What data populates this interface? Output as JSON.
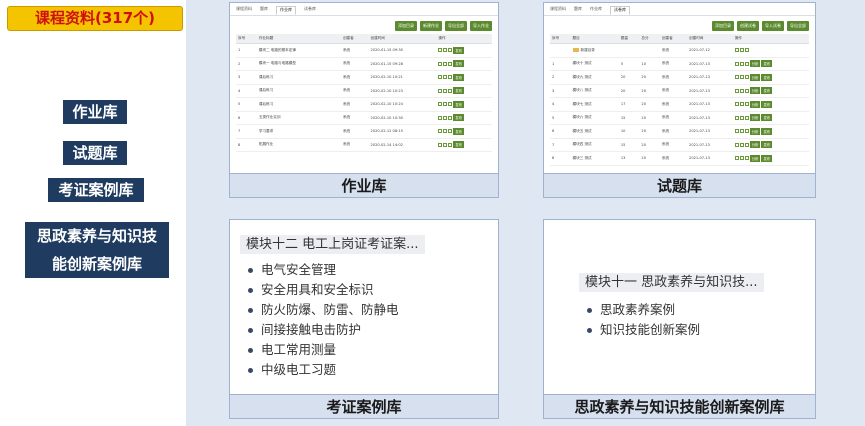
{
  "title": "课程资料(317个)",
  "nav": [
    "作业库",
    "试题库",
    "考证案例库",
    "思政素养与知识技",
    "能创新案例库"
  ],
  "homework_panel": {
    "caption": "作业库",
    "tabs": [
      "课程资料",
      "题库",
      "作业库",
      "试卷库"
    ],
    "active_tab": 2,
    "actions": [
      "添加目录",
      "新建作业",
      "导出全部",
      "导入作业"
    ],
    "columns": [
      "序号",
      "作业标题",
      "",
      "创建者",
      "创建时间",
      "操作"
    ],
    "rows": [
      {
        "title": "模块二 电路的基本定律",
        "creator": "系统",
        "time": "2020-01-15 09:30"
      },
      {
        "title": "模块一 电路与电路模型",
        "creator": "系统",
        "time": "2020-01-15 09:28"
      },
      {
        "title": "课后练习",
        "creator": "系统",
        "time": "2020-02-10 10:21"
      },
      {
        "title": "课后练习",
        "creator": "系统",
        "time": "2020-02-10 10:23"
      },
      {
        "title": "课后练习",
        "creator": "系统",
        "time": "2020-02-10 10:24"
      },
      {
        "title": "五类作业实训",
        "creator": "系统",
        "time": "2020-02-10 10:30"
      },
      {
        "title": "学习要求",
        "creator": "系统",
        "time": "2020-02-12 08:15"
      },
      {
        "title": "拓展作业",
        "creator": "系统",
        "time": "2020-02-14 14:02"
      }
    ],
    "op_label": "发布"
  },
  "question_panel": {
    "caption": "试题库",
    "tabs": [
      "课程资料",
      "题库",
      "作业库",
      "试卷库"
    ],
    "active_tab": 3,
    "actions": [
      "添加目录",
      "创建试卷",
      "导入试卷",
      "导出全部"
    ],
    "columns": [
      "序号",
      "题目",
      "题量",
      "总分",
      "创建者",
      "创建时间",
      "操作"
    ],
    "folder_row": {
      "title": "新建目录",
      "creator": "系统",
      "time": "2021-07-12"
    },
    "rows": [
      {
        "title": "模块十 测试",
        "count": "5",
        "score": "10",
        "creator": "系统",
        "time": "2021-07-13"
      },
      {
        "title": "模块九 测试",
        "count": "20",
        "score": "20",
        "creator": "系统",
        "time": "2021-07-13"
      },
      {
        "title": "模块八 测试",
        "count": "20",
        "score": "20",
        "creator": "系统",
        "time": "2021-07-13"
      },
      {
        "title": "模块七 测试",
        "count": "17",
        "score": "20",
        "creator": "系统",
        "time": "2021-07-13"
      },
      {
        "title": "模块六 测试",
        "count": "15",
        "score": "20",
        "creator": "系统",
        "time": "2021-07-13"
      },
      {
        "title": "模块五 测试",
        "count": "10",
        "score": "20",
        "creator": "系统",
        "time": "2021-07-13"
      },
      {
        "title": "模块四 测试",
        "count": "15",
        "score": "20",
        "creator": "系统",
        "time": "2021-07-13"
      },
      {
        "title": "模块三 测试",
        "count": "13",
        "score": "20",
        "creator": "系统",
        "time": "2021-07-13"
      }
    ],
    "op_labels": [
      "分析",
      "发布"
    ]
  },
  "cert_panel": {
    "caption": "考证案例库",
    "heading": "模块十二 电工上岗证考证案...",
    "items": [
      "电气安全管理",
      "安全用具和安全标识",
      "防火防爆、防雷、防静电",
      "间接接触电击防护",
      "电工常用测量",
      "中级电工习题"
    ]
  },
  "ideology_panel": {
    "caption": "思政素养与知识技能创新案例库",
    "heading": "模块十一 思政素养与知识技...",
    "items": [
      "思政素养案例",
      "知识技能创新案例"
    ]
  }
}
